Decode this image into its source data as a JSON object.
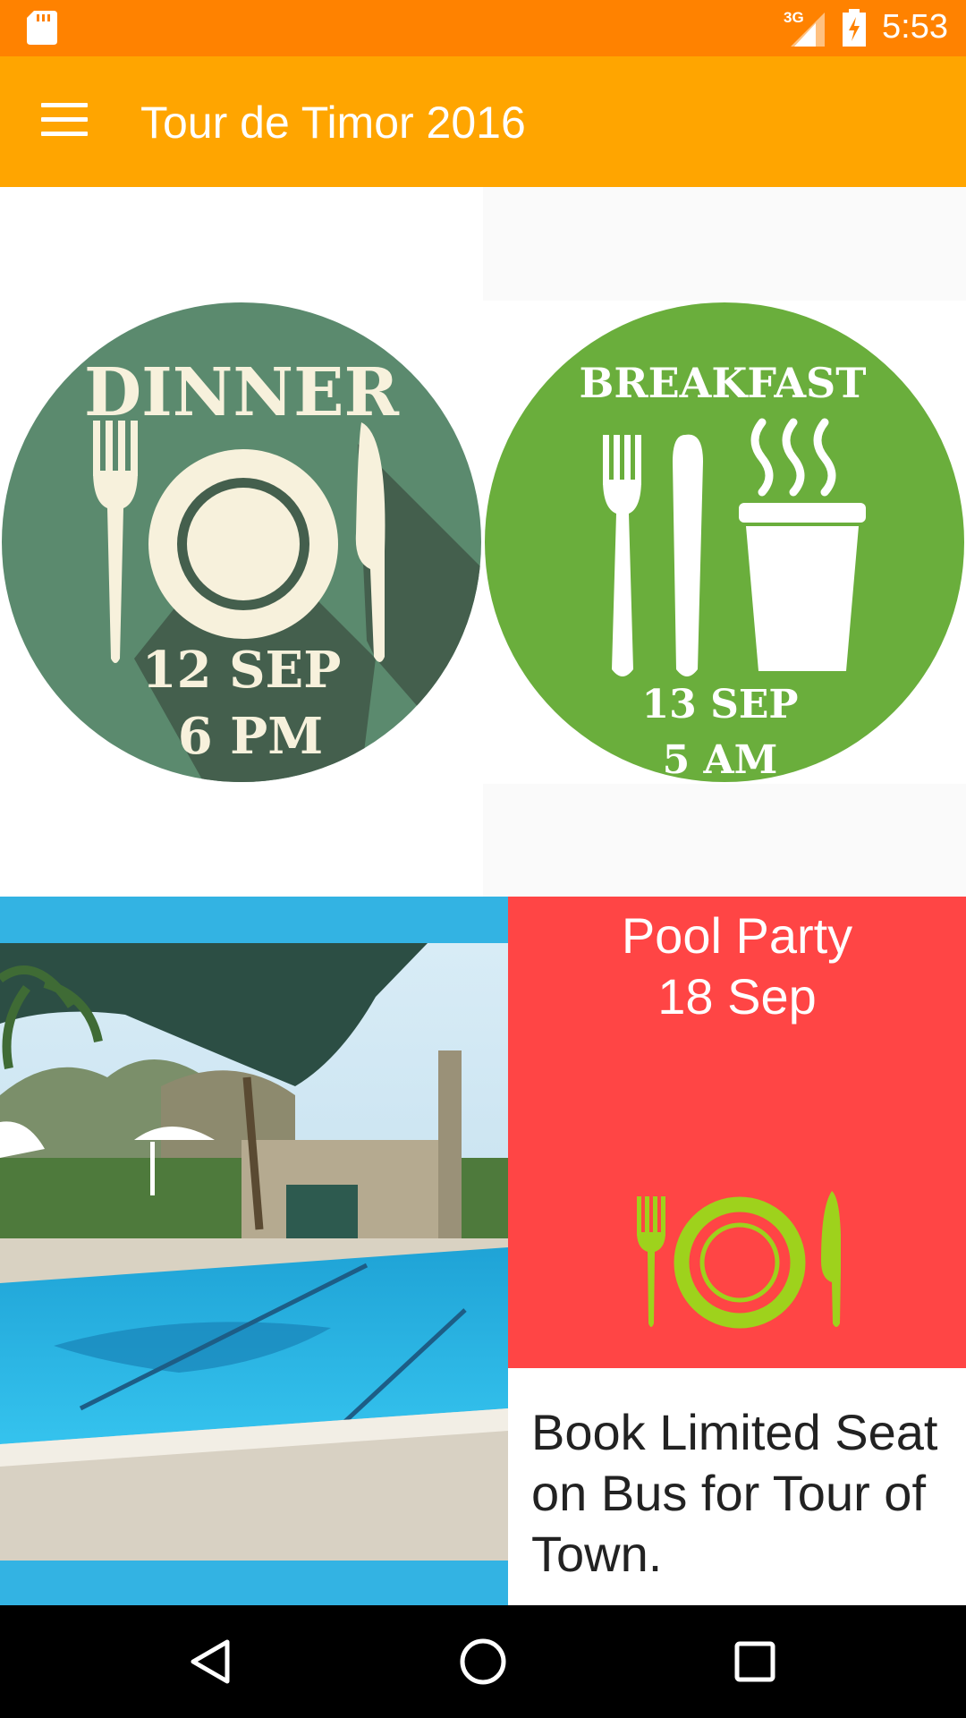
{
  "status_bar": {
    "time": "5:53",
    "network_type": "3G",
    "background_color": "#ff8200",
    "icons": [
      "sd-card-icon",
      "signal-icon",
      "battery-charging-icon"
    ]
  },
  "app_bar": {
    "title": "Tour de Timor 2016",
    "background_color": "#ffa500",
    "menu_icon": "hamburger-menu-icon"
  },
  "events": {
    "dinner": {
      "title": "DINNER",
      "date": "12 SEP",
      "time": "6 PM",
      "color": "#5b8a6e"
    },
    "breakfast": {
      "title": "BREAKFAST",
      "date": "13 SEP",
      "time": "5 AM",
      "color": "#6aae3c"
    },
    "pool_party": {
      "line1": "Pool Party",
      "line2": "18 Sep",
      "background_color": "#ff4545",
      "icon": "dining-icon"
    },
    "bus_tour": {
      "text": "Book Limited Seat on Bus for Tour of Town."
    },
    "pool_photo": {
      "frame_color": "#33b3e3"
    }
  },
  "nav_bar": {
    "buttons": [
      "back-button",
      "home-button",
      "recents-button"
    ]
  }
}
